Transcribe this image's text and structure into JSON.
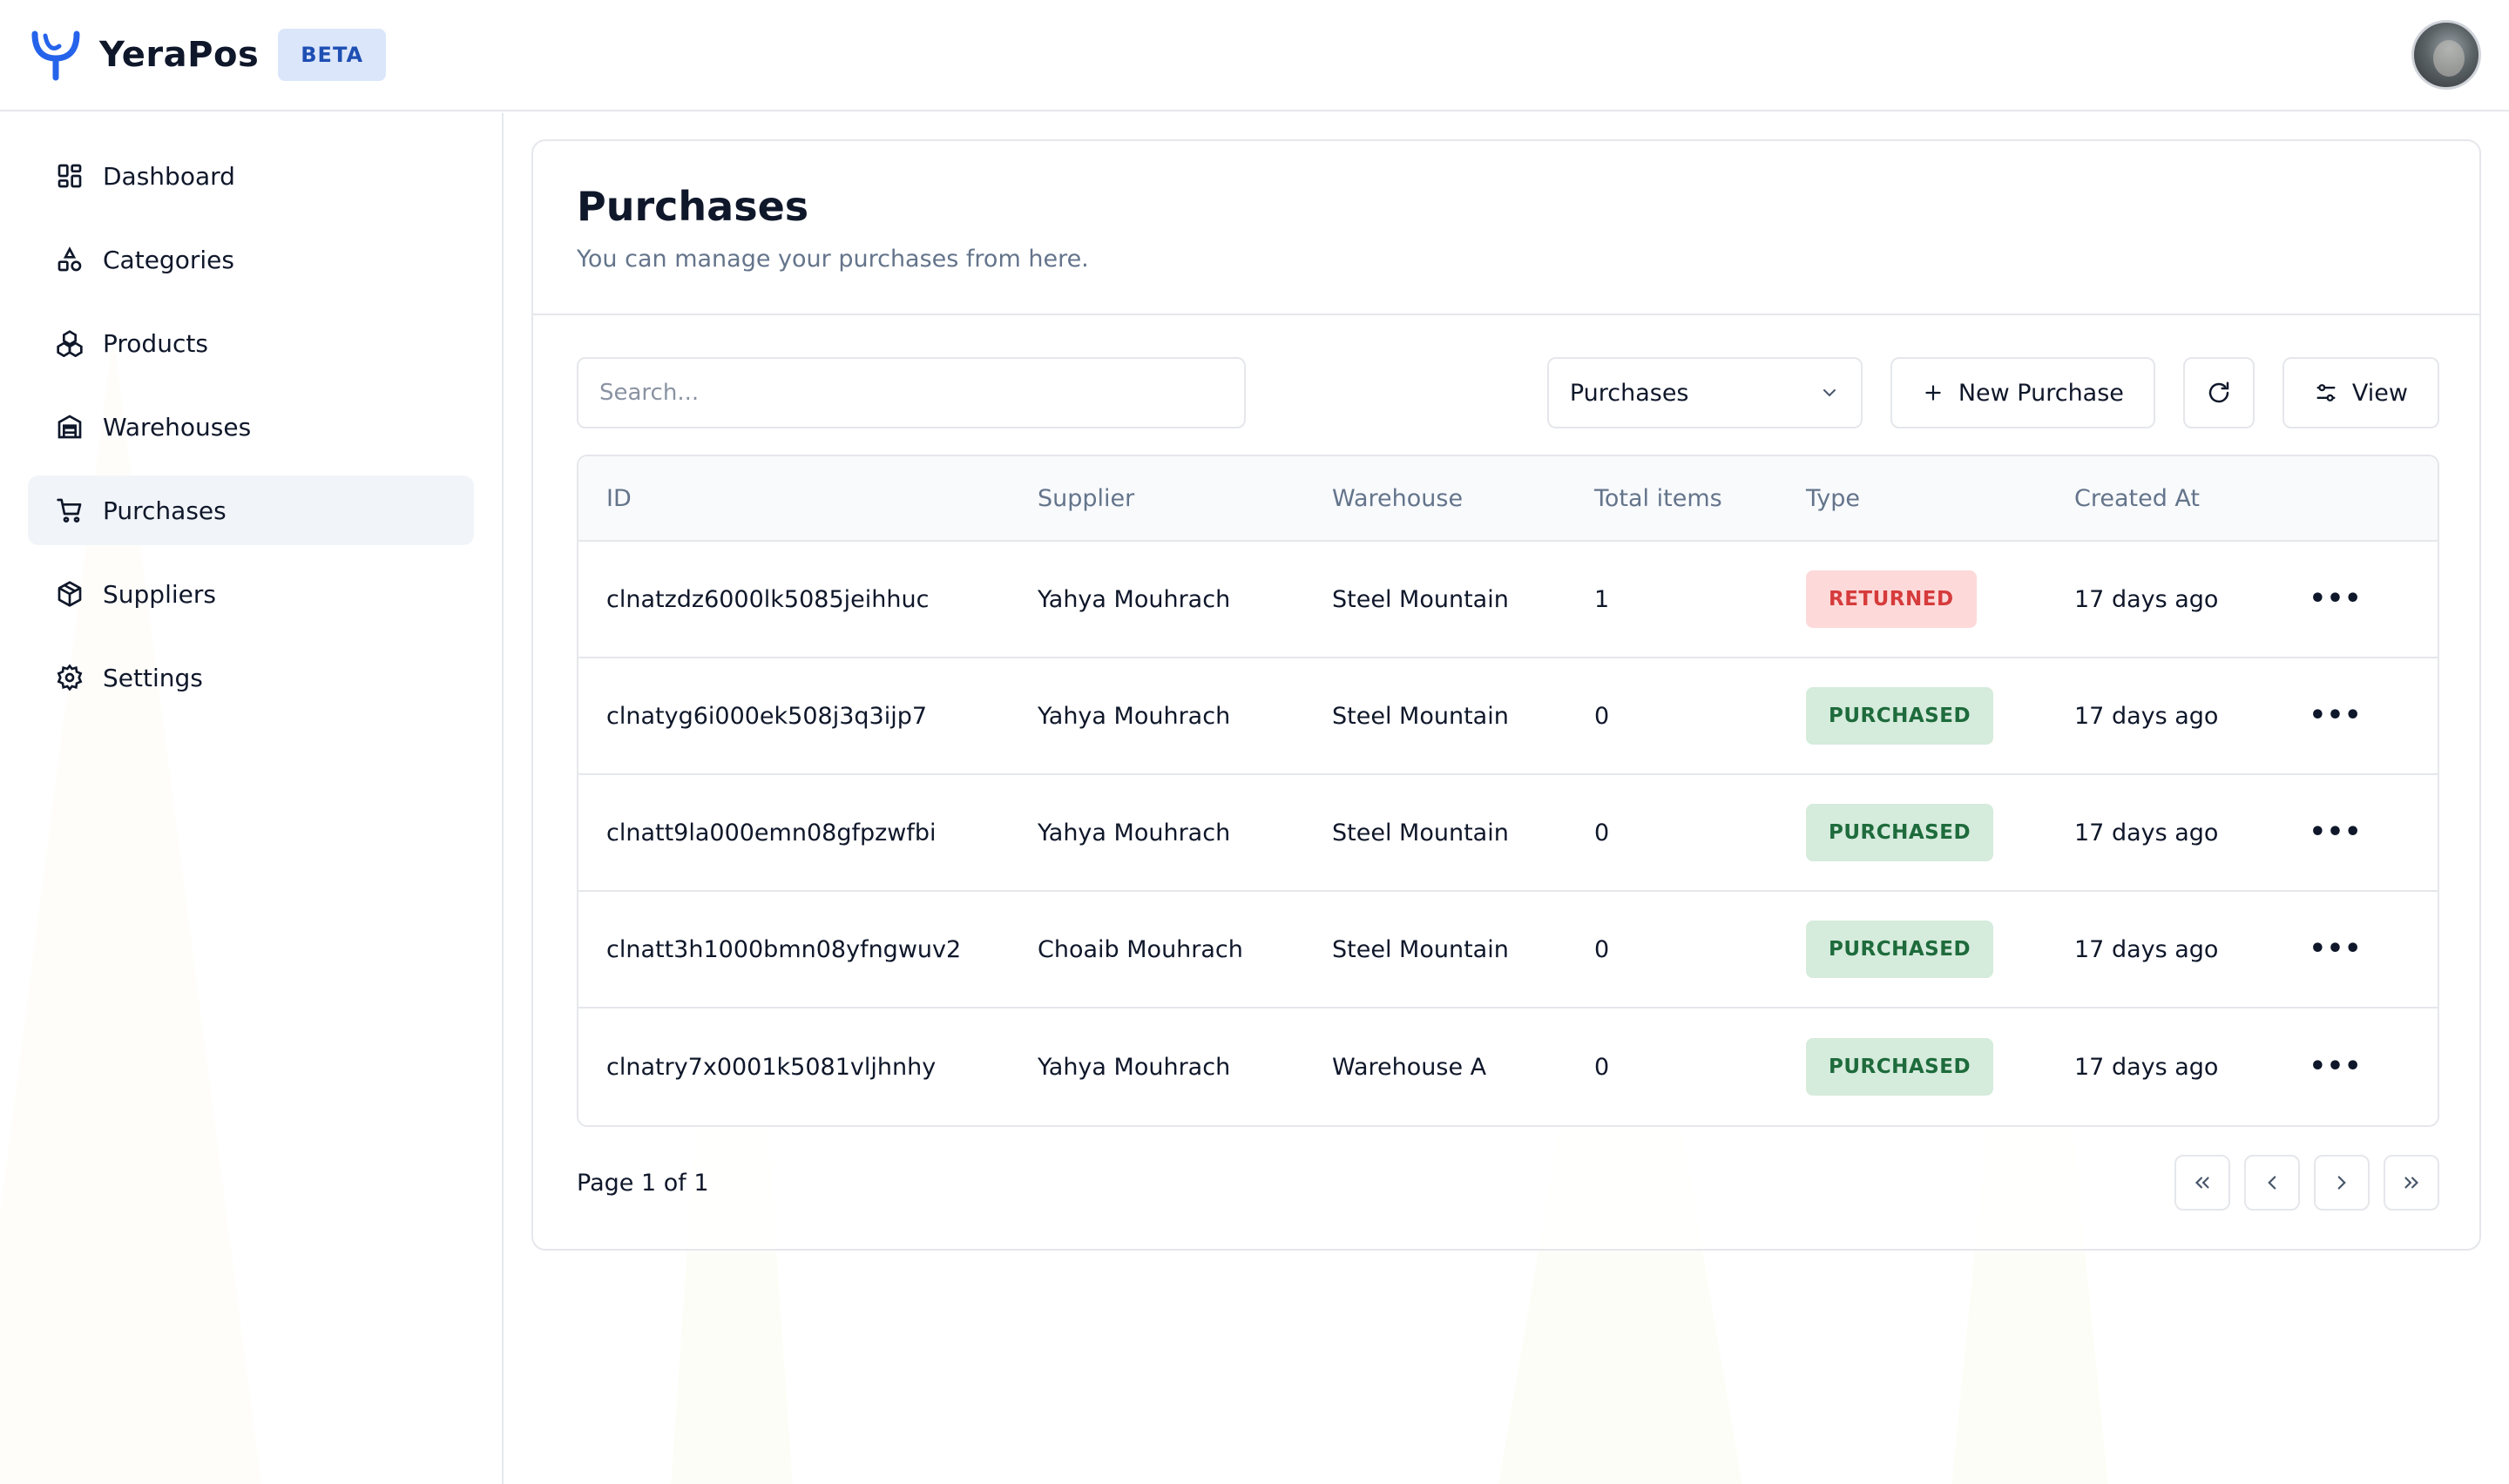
{
  "app": {
    "name": "YeraPos",
    "badge": "BETA",
    "brand_color": "#2563eb"
  },
  "sidebar": {
    "items": [
      {
        "label": "Dashboard",
        "icon": "dashboard-icon",
        "active": false
      },
      {
        "label": "Categories",
        "icon": "categories-icon",
        "active": false
      },
      {
        "label": "Products",
        "icon": "products-icon",
        "active": false
      },
      {
        "label": "Warehouses",
        "icon": "warehouse-icon",
        "active": false
      },
      {
        "label": "Purchases",
        "icon": "cart-icon",
        "active": true
      },
      {
        "label": "Suppliers",
        "icon": "package-icon",
        "active": false
      },
      {
        "label": "Settings",
        "icon": "gear-icon",
        "active": false
      }
    ]
  },
  "page": {
    "title": "Purchases",
    "subtitle": "You can manage your purchases from here."
  },
  "toolbar": {
    "search_placeholder": "Search...",
    "filter_value": "Purchases",
    "new_label": "New Purchase",
    "view_label": "View"
  },
  "table": {
    "columns": [
      "ID",
      "Supplier",
      "Warehouse",
      "Total items",
      "Type",
      "Created At"
    ],
    "rows": [
      {
        "id": "clnatzdz6000lk5085jeihhuc",
        "supplier": "Yahya Mouhrach",
        "warehouse": "Steel Mountain",
        "total": "1",
        "type": "RETURNED",
        "created": "17 days ago"
      },
      {
        "id": "clnatyg6i000ek508j3q3ijp7",
        "supplier": "Yahya Mouhrach",
        "warehouse": "Steel Mountain",
        "total": "0",
        "type": "PURCHASED",
        "created": "17 days ago"
      },
      {
        "id": "clnatt9la000emn08gfpzwfbi",
        "supplier": "Yahya Mouhrach",
        "warehouse": "Steel Mountain",
        "total": "0",
        "type": "PURCHASED",
        "created": "17 days ago"
      },
      {
        "id": "clnatt3h1000bmn08yfngwuv2",
        "supplier": "Choaib Mouhrach",
        "warehouse": "Steel Mountain",
        "total": "0",
        "type": "PURCHASED",
        "created": "17 days ago"
      },
      {
        "id": "clnatry7x0001k5081vljhnhy",
        "supplier": "Yahya Mouhrach",
        "warehouse": "Warehouse A",
        "total": "0",
        "type": "PURCHASED",
        "created": "17 days ago"
      }
    ],
    "row_action_icon": "more-horizontal-icon"
  },
  "pagination": {
    "label": "Page 1 of 1"
  },
  "colors": {
    "returned_bg": "#fdd9d9",
    "returned_text": "#d63b3b",
    "purchased_bg": "#d5ebdc",
    "purchased_text": "#1e6b3c"
  }
}
